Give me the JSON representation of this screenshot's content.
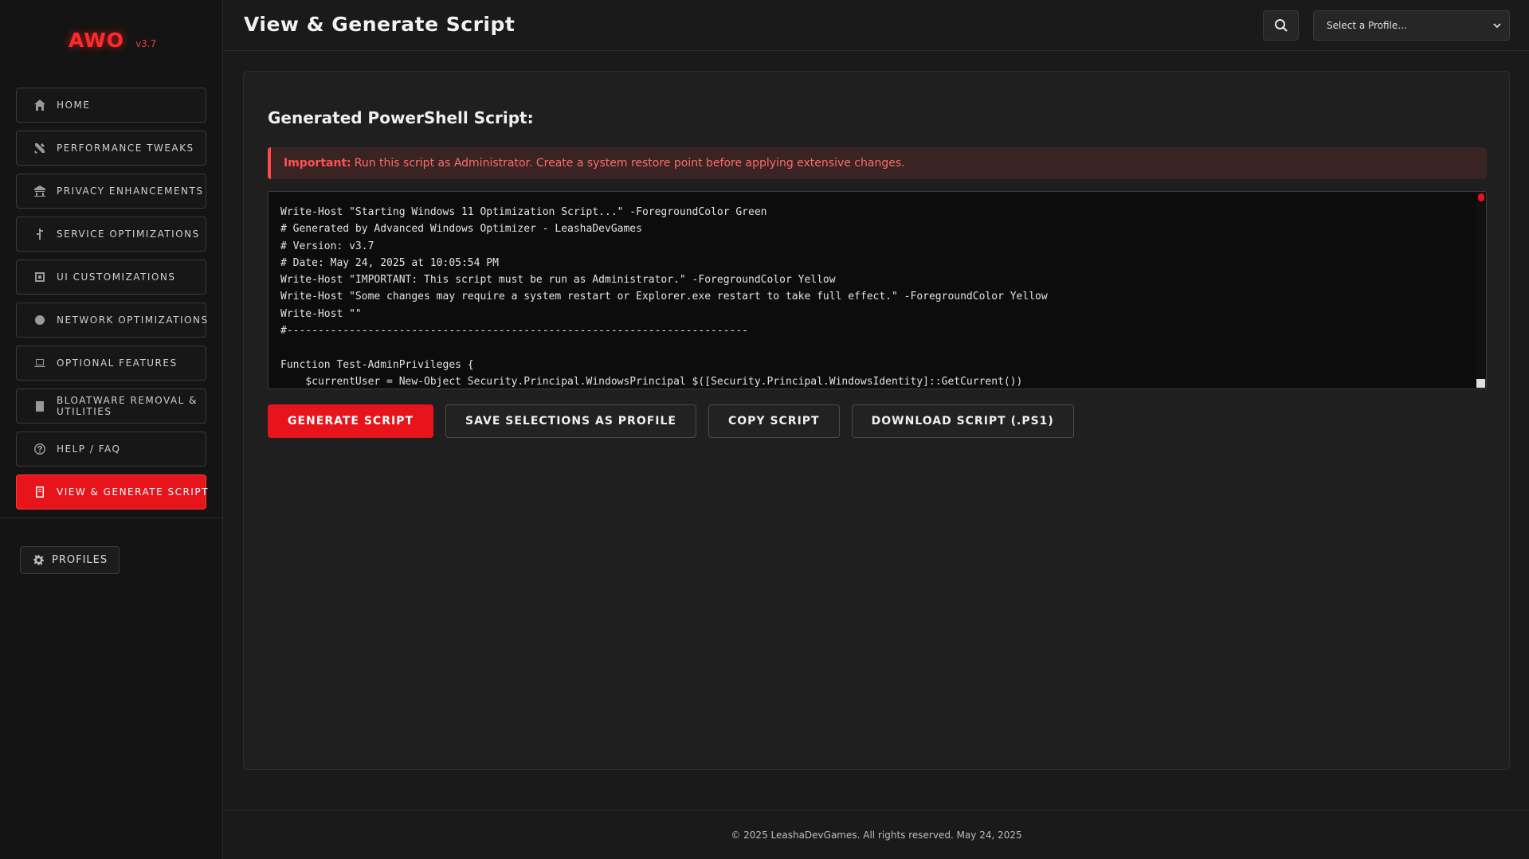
{
  "brand": {
    "logo": "AWO",
    "version": "v3.7",
    "accent_color": "#e8141c"
  },
  "sidebar": {
    "items": [
      {
        "label": "HOME",
        "icon": "home-icon"
      },
      {
        "label": "PERFORMANCE TWEAKS",
        "icon": "tools-icon"
      },
      {
        "label": "PRIVACY ENHANCEMENTS",
        "icon": "privacy-icon"
      },
      {
        "label": "SERVICE OPTIMIZATIONS",
        "icon": "service-icon"
      },
      {
        "label": "UI CUSTOMIZATIONS",
        "icon": "palette-icon"
      },
      {
        "label": "NETWORK OPTIMIZATIONS",
        "icon": "network-icon"
      },
      {
        "label": "OPTIONAL FEATURES",
        "icon": "laptop-icon"
      },
      {
        "label": "BLOATWARE REMOVAL & UTILITIES",
        "icon": "trash-icon"
      },
      {
        "label": "HELP / FAQ",
        "icon": "help-icon"
      },
      {
        "label": "VIEW & GENERATE SCRIPT",
        "icon": "script-icon",
        "active": true
      }
    ],
    "profiles_label": "PROFILES"
  },
  "header": {
    "title": "View & Generate Script",
    "profile_select": {
      "selected": "Select a Profile..."
    }
  },
  "main": {
    "section_title": "Generated PowerShell Script:",
    "alert": {
      "prefix": "Important:",
      "text": "Run this script as Administrator. Create a system restore point before applying extensive changes."
    },
    "script_lines": [
      "Write-Host \"Starting Windows 11 Optimization Script...\" -ForegroundColor Green",
      "# Generated by Advanced Windows Optimizer - LeashaDevGames",
      "# Version: v3.7",
      "# Date: May 24, 2025 at 10:05:54 PM",
      "Write-Host \"IMPORTANT: This script must be run as Administrator.\" -ForegroundColor Yellow",
      "Write-Host \"Some changes may require a system restart or Explorer.exe restart to take full effect.\" -ForegroundColor Yellow",
      "Write-Host \"\"",
      "#--------------------------------------------------------------------------",
      "",
      "Function Test-AdminPrivileges {",
      "    $currentUser = New-Object Security.Principal.WindowsPrincipal $([Security.Principal.WindowsIdentity]::GetCurrent())"
    ],
    "buttons": {
      "generate": "GENERATE SCRIPT",
      "save_profile": "SAVE SELECTIONS AS PROFILE",
      "copy": "COPY SCRIPT",
      "download": "DOWNLOAD SCRIPT (.PS1)"
    }
  },
  "footer": {
    "text": "© 2025 LeashaDevGames. All rights reserved. May 24, 2025"
  }
}
